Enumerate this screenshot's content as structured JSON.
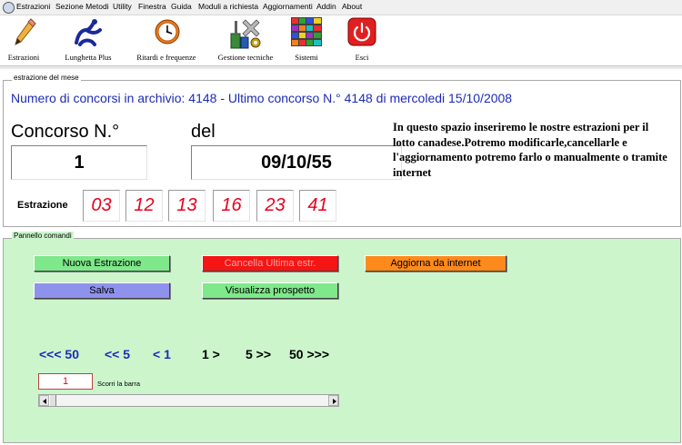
{
  "menu": [
    "Estrazioni",
    "Sezione Metodi",
    "Utility",
    "Finestra",
    "Guida",
    "Moduli a richiesta",
    "Aggiornamenti",
    "Addin",
    "About"
  ],
  "toolbar": {
    "estrazioni": "Estrazioni",
    "lunghetta": "Lunghetta Plus",
    "ritardi": "Ritardi e frequenze",
    "gestione": "Gestione tecniche",
    "sistemi": "Sistemi",
    "esci": "Esci"
  },
  "mese": {
    "title": "estrazione del mese",
    "archive_line": "Numero di concorsi in archivio: 4148   -   Ultimo concorso N.° 4148 di mercoledi 15/10/2008",
    "concorso_label": "Concorso N.°",
    "del_label": "del",
    "concorso_value": "1",
    "data_value": "09/10/55",
    "estrazione_label": "Estrazione",
    "numbers": [
      "03",
      "12",
      "13",
      "16",
      "23",
      "41"
    ]
  },
  "annotation": "In questo spazio inseriremo le nostre estrazioni per il lotto canadese.Potremo modificarle,cancellarle e l'aggiornamento potremo farlo o manualmente o tramite internet",
  "pannello": {
    "title": "Pannello comandi",
    "nuova": "Nuova Estrazione",
    "cancella": "Cancella Ultima estr.",
    "aggiorna": "Aggiorna da internet",
    "salva": "Salva",
    "visualizza": "Visualizza prospetto",
    "nav": [
      "<<< 50",
      "<< 5",
      "< 1",
      "1 >",
      "5 >>",
      "50 >>>"
    ],
    "scroll_value": "1",
    "scroll_label": "Scorri la barra"
  },
  "colors": {
    "accent_blue": "#1c2bb8",
    "number_red": "#e8001c",
    "panel_green": "#ccf5cc",
    "btn_green": "#7ee88a",
    "btn_red": "#f51515",
    "btn_orange": "#ff8a1c",
    "btn_purple": "#8e92ec"
  }
}
